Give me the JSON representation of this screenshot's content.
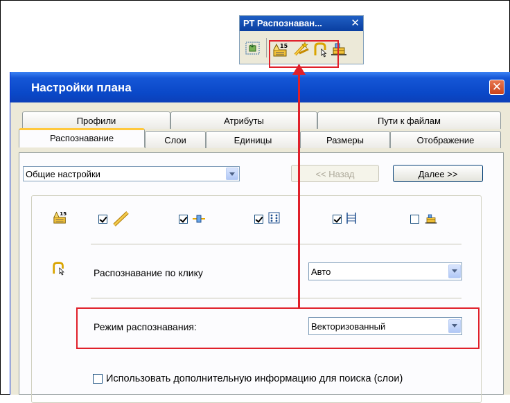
{
  "toolbar": {
    "title": "РТ Распознаван...",
    "close_glyph": "✕",
    "buttons": [
      "frame-select-icon",
      "recognize-counter-icon",
      "wand-icon",
      "click-recognize-icon",
      "plan-layer-icon"
    ]
  },
  "dialog": {
    "title": "Настройки плана",
    "close_glyph": "✕",
    "tabs_back_row": [
      "Профили",
      "Атрибуты",
      "Пути к файлам"
    ],
    "tabs_front_row": [
      "Распознавание",
      "Слои",
      "Единицы",
      "Размеры",
      "Отображение"
    ],
    "active_tab": "Распознавание",
    "settings_combo": {
      "value": "Общие настройки"
    },
    "back_button": "<< Назад",
    "next_button": "Далее >>",
    "checkboxes": [
      {
        "icon": "ruler-icon",
        "checked": true
      },
      {
        "icon": "crosshair-icon",
        "checked": true
      },
      {
        "icon": "dots-grid-icon",
        "checked": true
      },
      {
        "icon": "lines-icon",
        "checked": true
      },
      {
        "icon": "plan-layer-icon",
        "checked": false
      }
    ],
    "click_recognition": {
      "label": "Распознавание по клику",
      "value": "Авто"
    },
    "recognition_mode": {
      "label": "Режим распознавания:",
      "value": "Векторизованный"
    },
    "extra_info": {
      "label": "Использовать дополнительную информацию для поиска (слои)",
      "checked": false
    }
  },
  "colors": {
    "highlight": "#e0202a",
    "title_blue": "#0a48c8",
    "active_tab_accent": "#ffc83c"
  }
}
